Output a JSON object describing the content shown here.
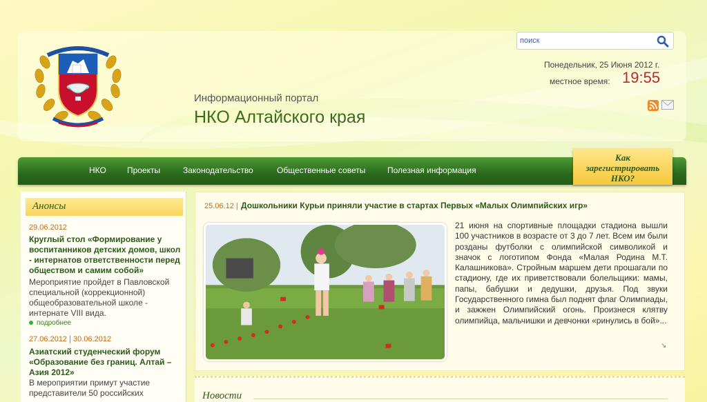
{
  "header": {
    "portal_subtitle": "Информационный портал",
    "portal_title": "НКО Алтайского края",
    "emblem_icon": "altai-krai-emblem-icon"
  },
  "search": {
    "placeholder": "поиск",
    "icon": "search-icon"
  },
  "datetime": {
    "date": "Понедельник, 25 Июня 2012 г.",
    "time_label": "местное время:",
    "time": "19:55"
  },
  "header_icons": [
    "rss-icon",
    "mail-icon"
  ],
  "nav": {
    "items": [
      {
        "label": "НКО"
      },
      {
        "label": "Проекты"
      },
      {
        "label": "Законодательство"
      },
      {
        "label": "Общественные советы"
      },
      {
        "label": "Полезная информация"
      }
    ],
    "register": {
      "line1": "Как",
      "line2": "зарегистрировать",
      "line3": "НКО?"
    }
  },
  "sidebar": {
    "heading": "Анонсы",
    "items": [
      {
        "date": "29.06.2012",
        "title": "Круглый стол «Формирование у воспитанников детских домов, школ - интернатов ответственности перед обществом и самим собой»",
        "text": "Мероприятие пройдет в Павловской специальной (коррекционной) общеобразовательной школе - интернате VIII вида.",
        "more": "подробнее"
      },
      {
        "date": "27.06.2012 | 30.06.2012",
        "title": "Азиатский студенческий форум «Образование без границ. Алтай – Азия 2012»",
        "text": "В мероприятии примут участие представители 50 российских"
      }
    ]
  },
  "news": {
    "date": "25.06.12 |",
    "title": "Дошкольники Курьи приняли участие в стартах Первых «Малых Олимпийских игр»",
    "body": "21 июня на спортивные площадки стадиона вышли 100 участников в возрасте от 3 до 7 лет. Всем им были розданы футболки с олимпийской символикой и значок с логотипом Фонда «Малая Родина М.Т. Калашникова». Стройным маршем дети прошагали по стадиону, где их приветствовали болельщики: мамы, папы, бабушки и дедушки, друзья. Под звуки Государственного гимна был поднят флаг Олимпиады, и зажжен Олимпийский огонь. Произнеся клятву олимпийца, мальчишки и девчонки «ринулись в бой»...",
    "arrow_icon": "expand-arrow-icon"
  },
  "news_section": {
    "heading": "Новости"
  },
  "colors": {
    "nav_green": "#2a6a1c",
    "title_green": "#2b5a1a",
    "date_orange": "#c06b1a",
    "time_red": "#c0272d",
    "accent_yellow": "#f8d560"
  }
}
